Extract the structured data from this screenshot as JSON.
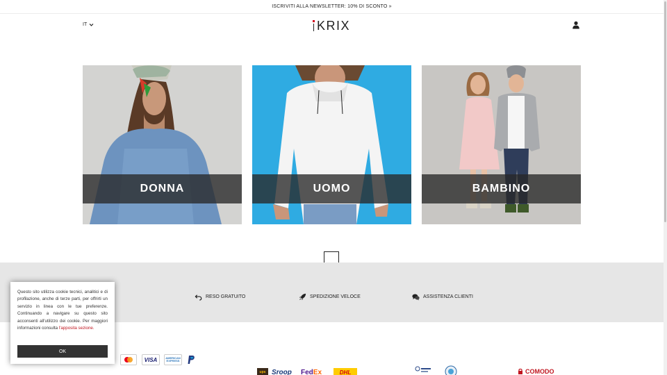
{
  "topbar": {
    "text": "ISCRIVITI ALLA NEWSLETTER: 10% DI SCONTO »"
  },
  "header": {
    "language": "IT",
    "logo_text": "KRIX",
    "icons": {
      "language": "chevron-down-icon",
      "account": "user-icon"
    }
  },
  "categories": [
    {
      "label": "DONNA"
    },
    {
      "label": "UOMO"
    },
    {
      "label": "BAMBINO"
    }
  ],
  "features": [
    {
      "label": "RESO GRATUITO",
      "icon": "return-arrow-icon"
    },
    {
      "label": "SPEDIZIONE VELOCE",
      "icon": "rocket-icon"
    },
    {
      "label": "ASSISTENZA CLIENTI",
      "icon": "chat-bubbles-icon"
    }
  ],
  "payments": {
    "visa": "VISA",
    "amex": "AMERICAN EXPRESS"
  },
  "shipping": {
    "ups": "ups",
    "sda": "Sroop",
    "fedex_a": "Fed",
    "fedex_b": "Ex",
    "dhl": "DHL"
  },
  "security": {
    "comodo": "COMODO"
  },
  "cookie": {
    "text": "Questo sito utilizza cookie tecnici, analitici e di profilazione, anche di terze parti, per offrirti un servizio in linea con le tue preferenze. Continuando a navigare su questo sito acconsenti all'utilizzo dei cookie. Per maggiori informazioni consulta",
    "link": "l'apposita sezione.",
    "button": "OK"
  },
  "colors": {
    "accent": "#d0021b",
    "features_bg": "#e6e6e6",
    "button_bg": "#333333"
  }
}
